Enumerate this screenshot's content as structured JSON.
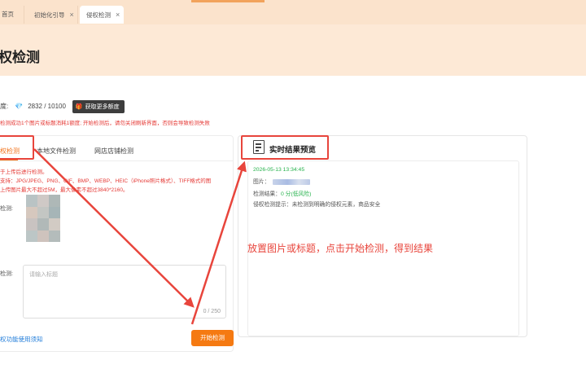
{
  "tabs": [
    {
      "label": "首页",
      "closable": false
    },
    {
      "label": "初始化引导",
      "closable": true
    },
    {
      "label": "侵权检测",
      "closable": true
    }
  ],
  "page": {
    "title": "权检测"
  },
  "quota": {
    "label": "度:",
    "value": "2832 / 10100",
    "button": "获取更多额度"
  },
  "notice": "检测成功1个图片或标题消耗1额度; 开始检测后，请勿关闭刷新界面，否则会导致检测失败",
  "left_panel": {
    "tabs": [
      "权检测",
      "本地文件检测",
      "网店店铺检测"
    ],
    "hints": [
      "于上传后进行检测。",
      "支持：JPG/JPEG、PNG、GIF、BMP、WEBP、HEIC（iPhone照片格式）、TIFF格式的图",
      "上传图片最大不超过5M，最大像素不超过3840*2160。"
    ],
    "image_label": "检测:",
    "title_label": "检测:",
    "title_placeholder": "请输入标题",
    "char_count": "0 / 250",
    "guide_link": "权功能使用须知",
    "start_button": "开始检测"
  },
  "result_panel": {
    "title": "实时结果预览",
    "timestamp": "2026-05-13 13:34:45",
    "image_label": "图片：",
    "result_prefix": "检测结果：",
    "score": "0 分",
    "risk": "(低风险)",
    "tip": "侵权检测提示：未检测到明确的侵权元素，商品安全"
  },
  "annotation": "放置图片或标题，点击开始检测，得到结果",
  "colors": {
    "accent": "#f57a12",
    "annotation": "#e8453c",
    "link": "#1e7bd9",
    "success": "#26b24c"
  }
}
